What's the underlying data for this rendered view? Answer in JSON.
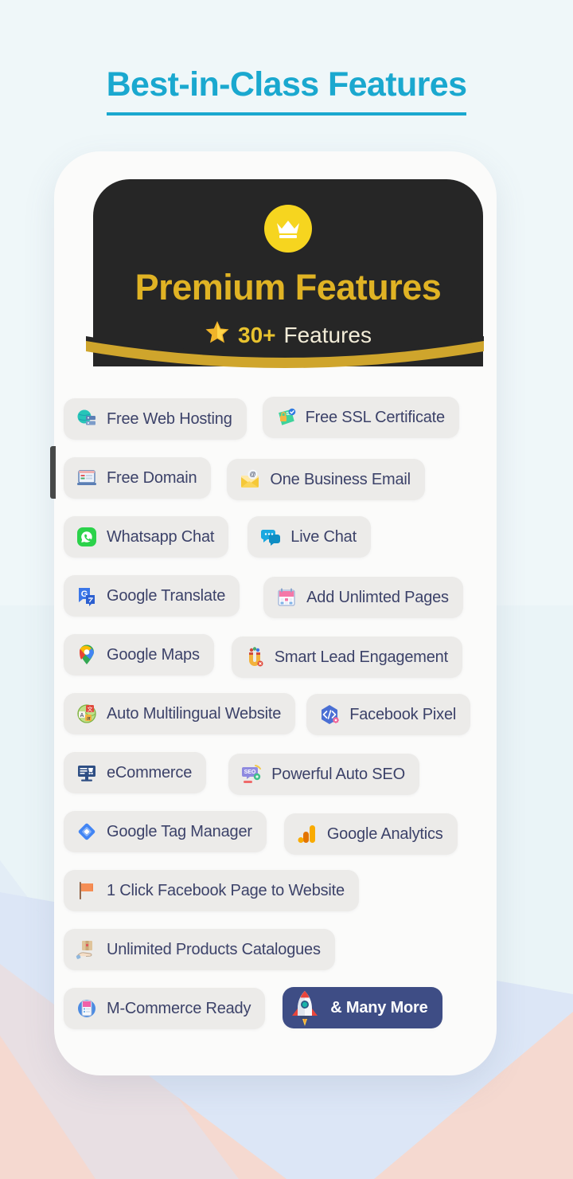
{
  "page": {
    "heading": "Best-in-Class Features",
    "accent_color": "#1aa8cf",
    "background_color": "#eaf4f7",
    "card_color": "#fbfbfa"
  },
  "premium_header": {
    "badge_icon": "crown-icon",
    "title": "Premium Features",
    "star_icon": "star-icon",
    "count": "30+",
    "count_label": "Features",
    "background_color": "#262626",
    "title_color": "#e0b324",
    "gold_accent": "#d4a92a"
  },
  "features": {
    "pill_bg": "#ecebe9",
    "pill_text_color": "#3c4269",
    "accent_pill_bg": "#3e4d85",
    "rows": [
      {
        "items": [
          {
            "label": "Free Web Hosting",
            "icon": "web-hosting-icon",
            "accent": false
          },
          {
            "label": "Free SSL Certificate",
            "icon": "ssl-certificate-icon",
            "accent": false
          }
        ]
      },
      {
        "items": [
          {
            "label": "Free Domain",
            "icon": "domain-laptop-icon",
            "accent": false
          },
          {
            "label": "One Business Email",
            "icon": "email-envelope-icon",
            "accent": false
          }
        ]
      },
      {
        "items": [
          {
            "label": "Whatsapp Chat",
            "icon": "whatsapp-icon",
            "accent": false
          },
          {
            "label": "Live Chat",
            "icon": "live-chat-icon",
            "accent": false
          }
        ]
      },
      {
        "items": [
          {
            "label": "Google Translate",
            "icon": "google-translate-icon",
            "accent": false
          },
          {
            "label": "Add Unlimted Pages",
            "icon": "pages-calendar-icon",
            "accent": false
          }
        ]
      },
      {
        "items": [
          {
            "label": "Google Maps",
            "icon": "google-maps-pin-icon",
            "accent": false
          },
          {
            "label": "Smart Lead Engagement",
            "icon": "lead-magnet-icon",
            "accent": false
          }
        ]
      },
      {
        "items": [
          {
            "label": "Auto Multilingual Website",
            "icon": "multilingual-globe-icon",
            "accent": false
          },
          {
            "label": "Facebook Pixel",
            "icon": "facebook-pixel-code-icon",
            "accent": false
          }
        ]
      },
      {
        "items": [
          {
            "label": "eCommerce",
            "icon": "ecommerce-monitor-icon",
            "accent": false
          },
          {
            "label": "Powerful Auto SEO",
            "icon": "seo-icon",
            "accent": false
          }
        ]
      },
      {
        "items": [
          {
            "label": "Google Tag Manager",
            "icon": "google-tag-manager-icon",
            "accent": false
          },
          {
            "label": "Google Analytics",
            "icon": "google-analytics-icon",
            "accent": false
          }
        ]
      },
      {
        "items": [
          {
            "label": "1 Click Facebook Page to Website",
            "icon": "orange-flag-icon",
            "accent": false
          }
        ]
      },
      {
        "items": [
          {
            "label": "Unlimited Products Catalogues",
            "icon": "product-box-hand-icon",
            "accent": false
          }
        ]
      },
      {
        "items": [
          {
            "label": "M-Commerce Ready",
            "icon": "mobile-commerce-icon",
            "accent": false
          },
          {
            "label": "& Many More",
            "icon": "rocket-icon",
            "accent": true
          }
        ]
      }
    ]
  }
}
